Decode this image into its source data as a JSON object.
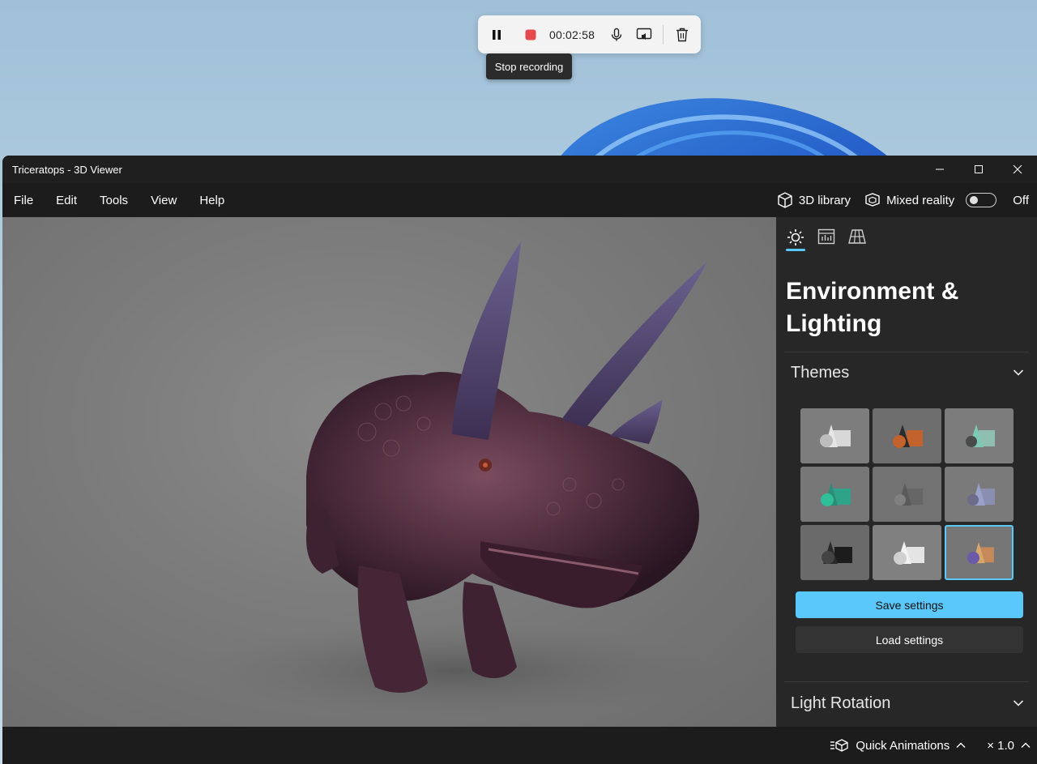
{
  "recorder": {
    "time": "00:02:58",
    "tooltip": "Stop recording",
    "icons": [
      "pause-icon",
      "stop-icon",
      "microphone-icon",
      "cast-screen-icon",
      "trash-icon"
    ]
  },
  "window": {
    "title": "Triceratops - 3D Viewer"
  },
  "menu": {
    "items": [
      "File",
      "Edit",
      "Tools",
      "View",
      "Help"
    ],
    "library": "3D library",
    "mixed_reality": "Mixed reality",
    "mixed_reality_state": "Off"
  },
  "panel": {
    "tabs": [
      "sun-icon",
      "stats-icon",
      "grid-icon"
    ],
    "title": "Environment & Lighting",
    "themes_label": "Themes",
    "theme_count": 9,
    "selected_theme_index": 8,
    "save_label": "Save settings",
    "load_label": "Load settings",
    "light_rotation_label": "Light Rotation"
  },
  "status": {
    "quick_animations": "Quick Animations",
    "speed": "× 1.0"
  },
  "colors": {
    "accent": "#5ac8fa",
    "stop": "#e5484d",
    "window_bg": "#202020",
    "panel_bg": "#272727"
  }
}
